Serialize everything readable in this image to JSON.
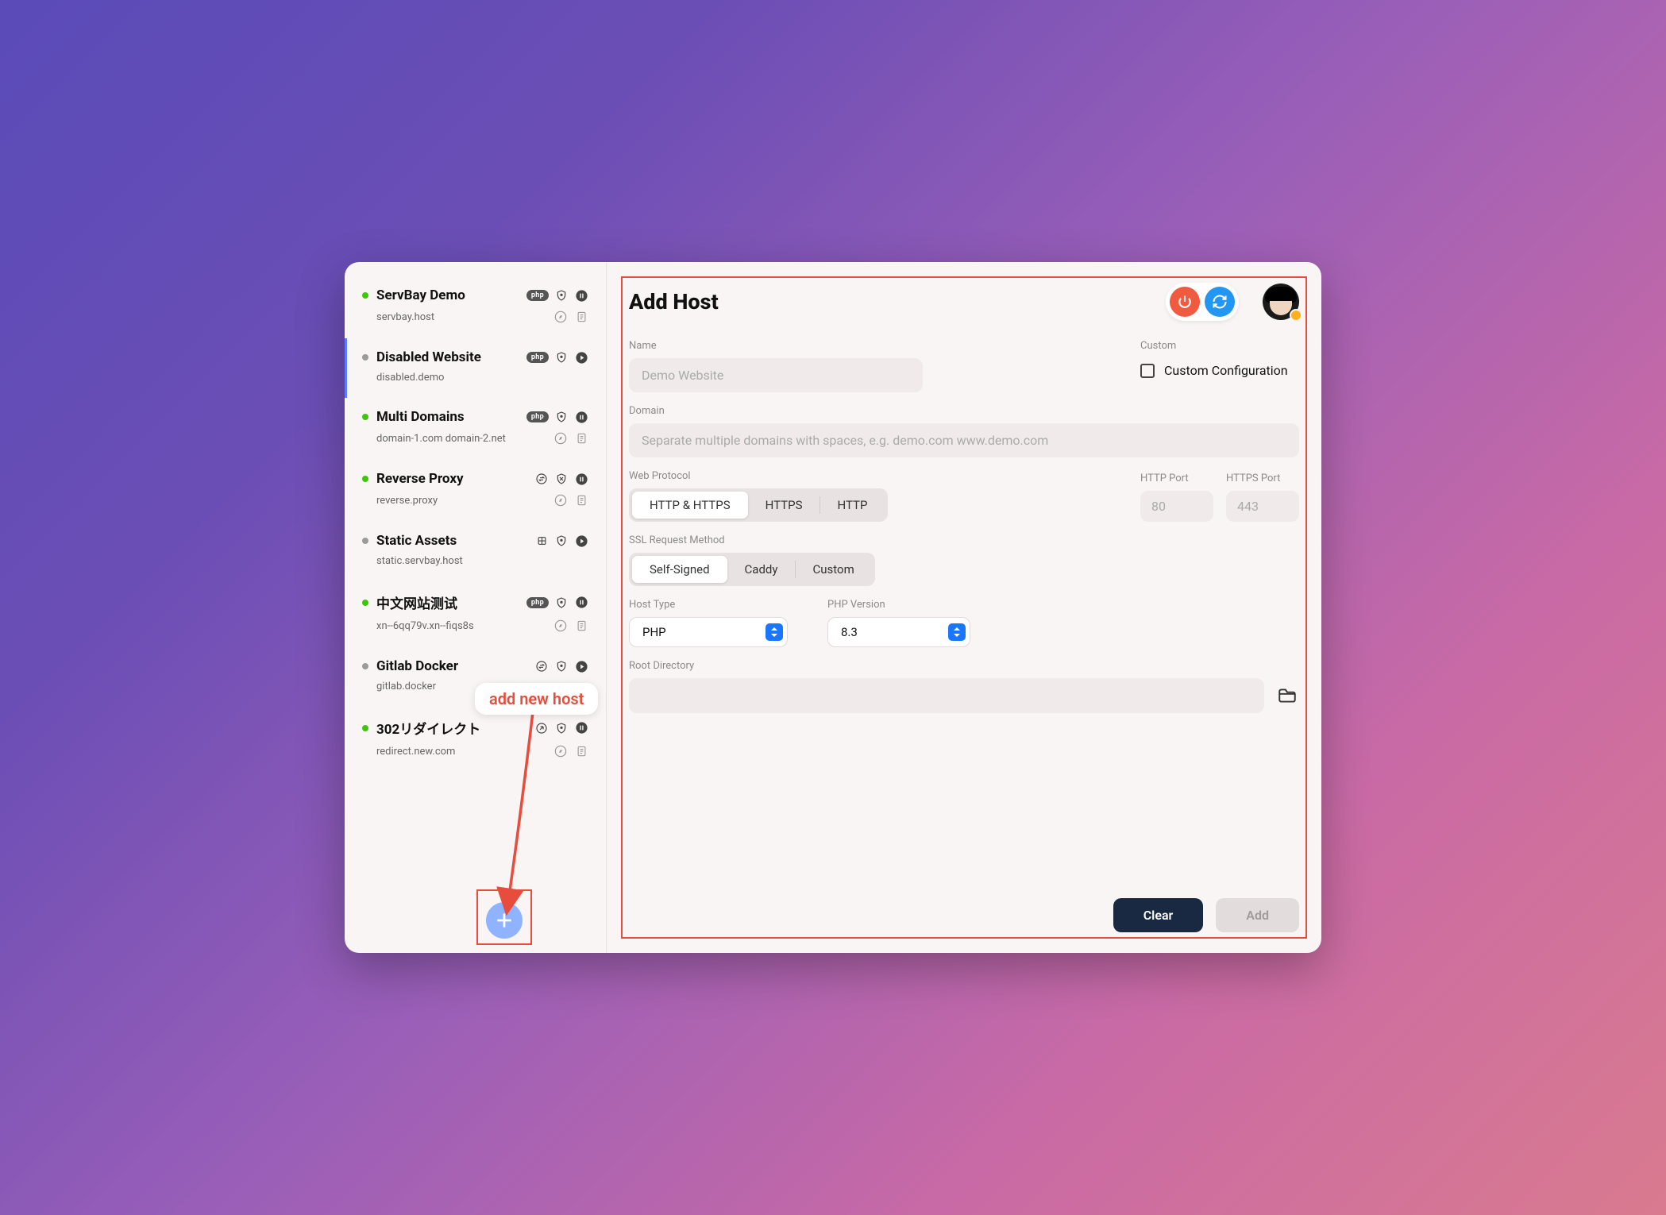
{
  "annotation": {
    "text": "add new host"
  },
  "sidebar": {
    "items": [
      {
        "name": "ServBay Demo",
        "domain": "servbay.host",
        "status": "green",
        "badge": "php",
        "rightIcons": [
          "shield",
          "pause"
        ],
        "secondaryIcons": [
          "compass",
          "note"
        ]
      },
      {
        "name": "Disabled Website",
        "domain": "disabled.demo",
        "status": "grey",
        "badge": "php",
        "rightIcons": [
          "shield",
          "play"
        ],
        "secondaryIcons": [],
        "selected": true
      },
      {
        "name": "Multi Domains",
        "domain": "domain-1.com domain-2.net",
        "status": "green",
        "badge": "php",
        "rightIcons": [
          "shield",
          "pause"
        ],
        "secondaryIcons": [
          "compass",
          "note"
        ]
      },
      {
        "name": "Reverse Proxy",
        "domain": "reverse.proxy",
        "status": "green",
        "badge": "swap",
        "rightIcons": [
          "shield-x",
          "pause"
        ],
        "secondaryIcons": [
          "compass",
          "note"
        ]
      },
      {
        "name": "Static Assets",
        "domain": "static.servbay.host",
        "status": "grey",
        "badge": "cube",
        "rightIcons": [
          "shield",
          "play"
        ],
        "secondaryIcons": []
      },
      {
        "name": "中文网站测试",
        "domain": "xn--6qq79v.xn--fiqs8s",
        "status": "green",
        "badge": "php",
        "rightIcons": [
          "shield",
          "pause"
        ],
        "secondaryIcons": [
          "compass",
          "note"
        ]
      },
      {
        "name": "Gitlab Docker",
        "domain": "gitlab.docker",
        "status": "grey",
        "badge": "swap",
        "rightIcons": [
          "shield",
          "play"
        ],
        "secondaryIcons": []
      },
      {
        "name": "302リダイレクト",
        "domain": "redirect.new.com",
        "status": "green",
        "badge": "redirect",
        "rightIcons": [
          "shield",
          "pause"
        ],
        "secondaryIcons": [
          "compass",
          "note"
        ]
      }
    ]
  },
  "main": {
    "title": "Add Host",
    "labels": {
      "name": "Name",
      "custom": "Custom",
      "customConfig": "Custom Configuration",
      "domain": "Domain",
      "webProtocol": "Web Protocol",
      "httpPort": "HTTP Port",
      "httpsPort": "HTTPS Port",
      "sslMethod": "SSL Request Method",
      "hostType": "Host Type",
      "phpVersion": "PHP Version",
      "rootDir": "Root Directory"
    },
    "placeholders": {
      "name": "Demo Website",
      "domain": "Separate multiple domains with spaces, e.g. demo.com www.demo.com",
      "httpPort": "80",
      "httpsPort": "443"
    },
    "protocol": {
      "options": [
        "HTTP & HTTPS",
        "HTTPS",
        "HTTP"
      ],
      "active": 0
    },
    "ssl": {
      "options": [
        "Self-Signed",
        "Caddy",
        "Custom"
      ],
      "active": 0
    },
    "hostType": {
      "value": "PHP"
    },
    "phpVersion": {
      "value": "8.3"
    },
    "footer": {
      "clear": "Clear",
      "add": "Add"
    }
  }
}
